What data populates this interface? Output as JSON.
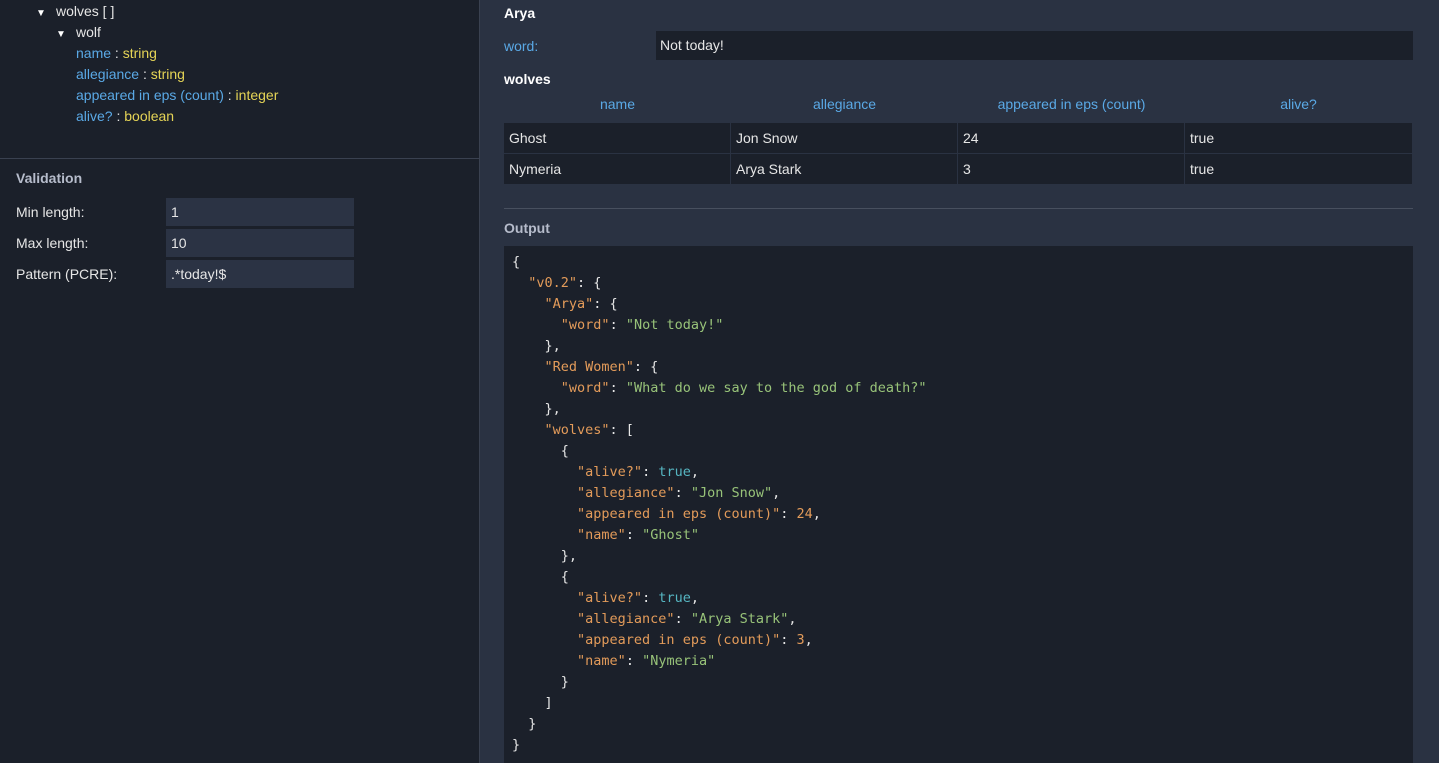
{
  "tree": {
    "wolves_label": "wolves [ ]",
    "wolf_label": "wolf",
    "fields": [
      {
        "name": "name",
        "type": "string"
      },
      {
        "name": "allegiance",
        "type": "string"
      },
      {
        "name": "appeared in eps (count)",
        "type": "integer"
      },
      {
        "name": "alive?",
        "type": "boolean"
      }
    ],
    "separator": " : "
  },
  "validation": {
    "title": "Validation",
    "min_label": "Min length:",
    "min_value": "1",
    "max_label": "Max length:",
    "max_value": "10",
    "pattern_label": "Pattern (PCRE):",
    "pattern_value": ".*today!$"
  },
  "form": {
    "arya_title": "Arya",
    "word_label": "word:",
    "word_value": "Not today!",
    "wolves_title": "wolves",
    "columns": [
      "name",
      "allegiance",
      "appeared in eps (count)",
      "alive?"
    ],
    "rows": [
      [
        "Ghost",
        "Jon Snow",
        "24",
        "true"
      ],
      [
        "Nymeria",
        "Arya Stark",
        "3",
        "true"
      ]
    ]
  },
  "output": {
    "title": "Output",
    "lines": [
      [
        [
          "p",
          "{"
        ]
      ],
      [
        [
          "p",
          "  "
        ],
        [
          "k",
          "\"v0.2\""
        ],
        [
          "p",
          ": {"
        ]
      ],
      [
        [
          "p",
          "    "
        ],
        [
          "k",
          "\"Arya\""
        ],
        [
          "p",
          ": {"
        ]
      ],
      [
        [
          "p",
          "      "
        ],
        [
          "k",
          "\"word\""
        ],
        [
          "p",
          ": "
        ],
        [
          "s",
          "\"Not today!\""
        ]
      ],
      [
        [
          "p",
          "    },"
        ]
      ],
      [
        [
          "p",
          "    "
        ],
        [
          "k",
          "\"Red Women\""
        ],
        [
          "p",
          ": {"
        ]
      ],
      [
        [
          "p",
          "      "
        ],
        [
          "k",
          "\"word\""
        ],
        [
          "p",
          ": "
        ],
        [
          "s",
          "\"What do we say to the god of death?\""
        ]
      ],
      [
        [
          "p",
          "    },"
        ]
      ],
      [
        [
          "p",
          "    "
        ],
        [
          "k",
          "\"wolves\""
        ],
        [
          "p",
          ": ["
        ]
      ],
      [
        [
          "p",
          "      {"
        ]
      ],
      [
        [
          "p",
          "        "
        ],
        [
          "k",
          "\"alive?\""
        ],
        [
          "p",
          ": "
        ],
        [
          "b",
          "true"
        ],
        [
          "p",
          ","
        ]
      ],
      [
        [
          "p",
          "        "
        ],
        [
          "k",
          "\"allegiance\""
        ],
        [
          "p",
          ": "
        ],
        [
          "s",
          "\"Jon Snow\""
        ],
        [
          "p",
          ","
        ]
      ],
      [
        [
          "p",
          "        "
        ],
        [
          "k",
          "\"appeared in eps (count)\""
        ],
        [
          "p",
          ": "
        ],
        [
          "n",
          "24"
        ],
        [
          "p",
          ","
        ]
      ],
      [
        [
          "p",
          "        "
        ],
        [
          "k",
          "\"name\""
        ],
        [
          "p",
          ": "
        ],
        [
          "s",
          "\"Ghost\""
        ]
      ],
      [
        [
          "p",
          "      },"
        ]
      ],
      [
        [
          "p",
          "      {"
        ]
      ],
      [
        [
          "p",
          "        "
        ],
        [
          "k",
          "\"alive?\""
        ],
        [
          "p",
          ": "
        ],
        [
          "b",
          "true"
        ],
        [
          "p",
          ","
        ]
      ],
      [
        [
          "p",
          "        "
        ],
        [
          "k",
          "\"allegiance\""
        ],
        [
          "p",
          ": "
        ],
        [
          "s",
          "\"Arya Stark\""
        ],
        [
          "p",
          ","
        ]
      ],
      [
        [
          "p",
          "        "
        ],
        [
          "k",
          "\"appeared in eps (count)\""
        ],
        [
          "p",
          ": "
        ],
        [
          "n",
          "3"
        ],
        [
          "p",
          ","
        ]
      ],
      [
        [
          "p",
          "        "
        ],
        [
          "k",
          "\"name\""
        ],
        [
          "p",
          ": "
        ],
        [
          "s",
          "\"Nymeria\""
        ]
      ],
      [
        [
          "p",
          "      }"
        ]
      ],
      [
        [
          "p",
          "    ]"
        ]
      ],
      [
        [
          "p",
          "  }"
        ]
      ],
      [
        [
          "p",
          "}"
        ]
      ]
    ]
  },
  "colors": {
    "background": "#1b202a",
    "panel": "#2a3242",
    "key_blue": "#5aa9e6",
    "type_yellow": "#e5d456",
    "json_key": "#e39b5a",
    "json_string": "#98c379",
    "json_bool": "#56b6c2"
  }
}
